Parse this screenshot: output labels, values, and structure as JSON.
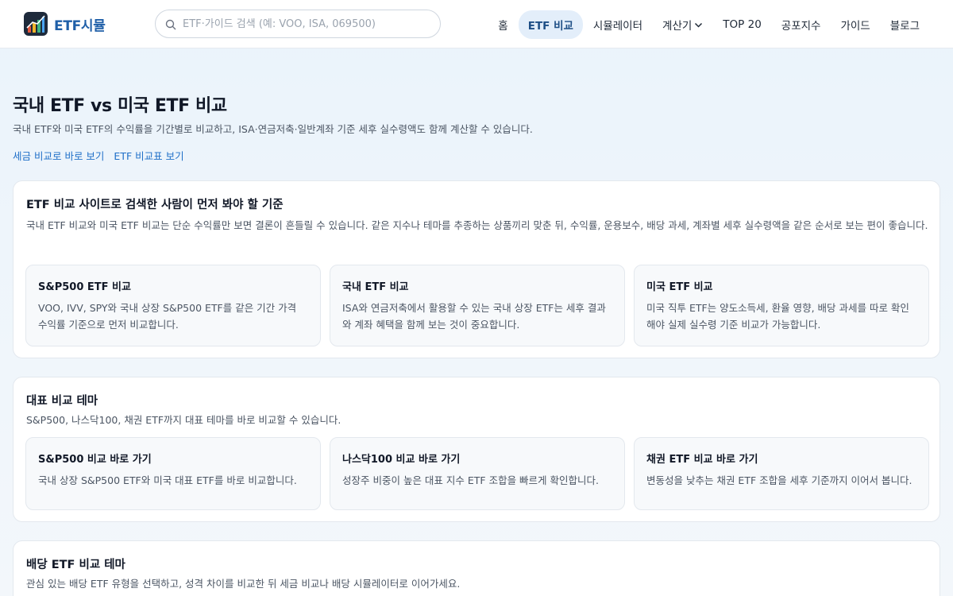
{
  "header": {
    "logo_text": "ETF시뮬",
    "search_placeholder": "ETF·가이드 검색 (예: VOO, ISA, 069500)",
    "nav": [
      {
        "label": "홈",
        "active": false
      },
      {
        "label": "ETF 비교",
        "active": true
      },
      {
        "label": "시뮬레이터",
        "active": false
      },
      {
        "label": "계산기",
        "active": false,
        "dropdown": true
      },
      {
        "label": "TOP 20",
        "active": false
      },
      {
        "label": "공포지수",
        "active": false
      },
      {
        "label": "가이드",
        "active": false
      },
      {
        "label": "블로그",
        "active": false
      }
    ]
  },
  "main": {
    "title": "국내 ETF vs 미국 ETF 비교",
    "subtitle": "국내 ETF와 미국 ETF의 수익률을 기간별로 비교하고, ISA·연금저축·일반계좌 기준 세후 실수령액도 함께 계산할 수 있습니다.",
    "links": [
      "세금 비교로 바로 보기",
      "ETF 비교표 보기"
    ]
  },
  "section1": {
    "title": "ETF 비교 사이트로 검색한 사람이 먼저 봐야 할 기준",
    "desc": "국내 ETF 비교와 미국 ETF 비교는 단순 수익률만 보면 결론이 흔들릴 수 있습니다. 같은 지수나 테마를 추종하는 상품끼리 맞춘 뒤, 수익률, 운용보수, 배당 과세, 계좌별 세후 실수령액을 같은 순서로 보는 편이 좋습니다.",
    "cards": [
      {
        "title": "S&P500 ETF 비교",
        "text": "VOO, IVV, SPY와 국내 상장 S&P500 ETF를 같은 기간 가격 수익률 기준으로 먼저 비교합니다."
      },
      {
        "title": "국내 ETF 비교",
        "text": "ISA와 연금저축에서 활용할 수 있는 국내 상장 ETF는 세후 결과와 계좌 혜택을 함께 보는 것이 중요합니다."
      },
      {
        "title": "미국 ETF 비교",
        "text": "미국 직투 ETF는 양도소득세, 환율 영향, 배당 과세를 따로 확인해야 실제 실수령 기준 비교가 가능합니다."
      }
    ]
  },
  "section2": {
    "title": "대표 비교 테마",
    "desc": "S&P500, 나스닥100, 채권 ETF까지 대표 테마를 바로 비교할 수 있습니다.",
    "cards": [
      {
        "title": "S&P500 비교 바로 가기",
        "text": "국내 상장 S&P500 ETF와 미국 대표 ETF를 바로 비교합니다."
      },
      {
        "title": "나스닥100 비교 바로 가기",
        "text": "성장주 비중이 높은 대표 지수 ETF 조합을 빠르게 확인합니다."
      },
      {
        "title": "채권 ETF 비교 바로 가기",
        "text": "변동성을 낮추는 채권 ETF 조합을 세후 기준까지 이어서 봅니다."
      }
    ]
  },
  "section3": {
    "title": "배당 ETF 비교 테마",
    "desc": "관심 있는 배당 ETF 유형을 선택하고, 성격 차이를 비교한 뒤 세금 비교나 배당 시뮬레이터로 이어가세요."
  },
  "colors": {
    "accent": "#1f6fc8",
    "logo_text": "#1f5fa8",
    "nav_active_bg": "#e3eefa",
    "nav_active_text": "#1e4f86"
  }
}
